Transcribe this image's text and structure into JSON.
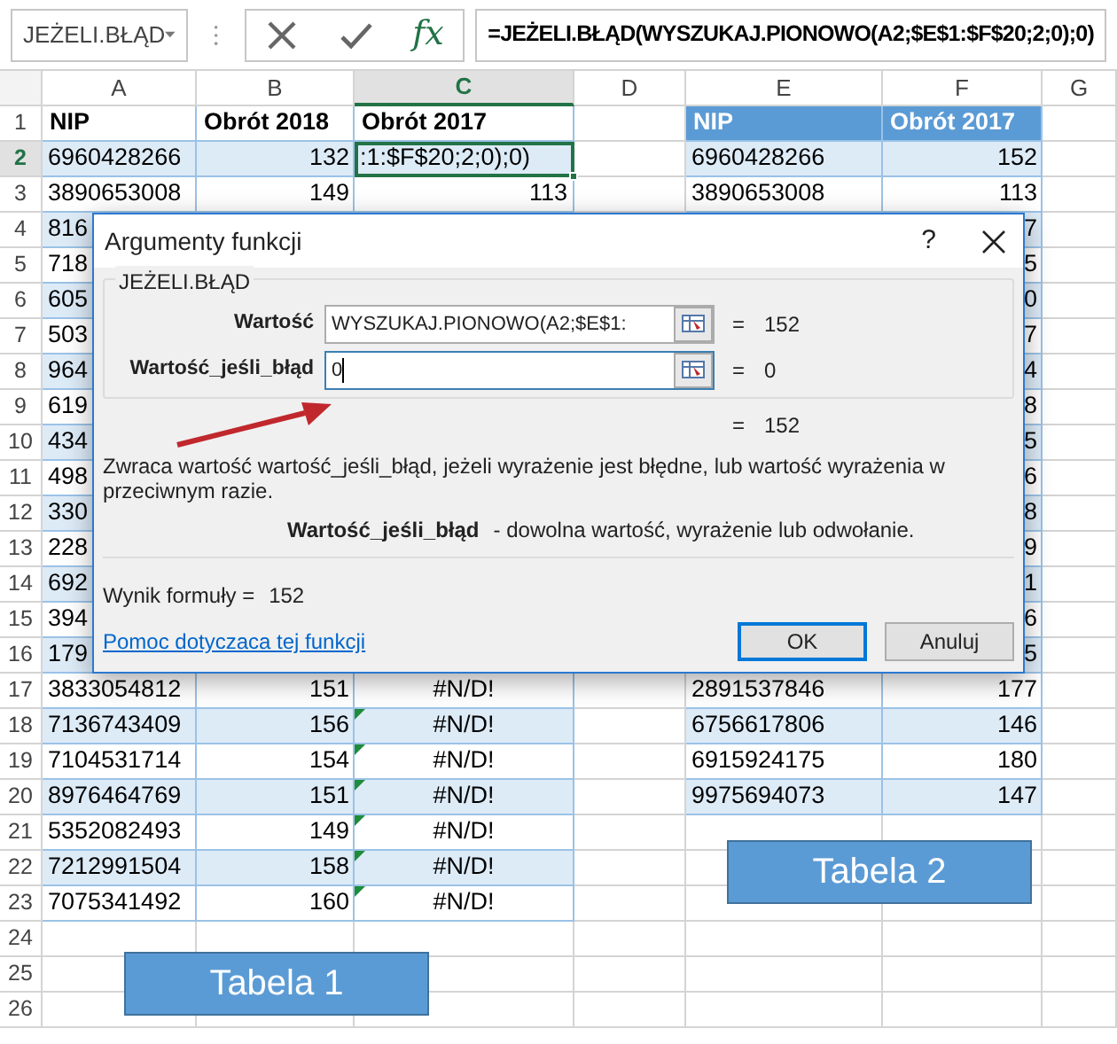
{
  "name_box": "JEŻELI.BŁĄD",
  "formula_bar": {
    "fx_label": "fx",
    "formula": "=JEŻELI.BŁĄD(WYSZUKAJ.PIONOWO(A2;$E$1:$F$20;2;0);0)"
  },
  "columns": [
    {
      "label": "A",
      "selected": false
    },
    {
      "label": "B",
      "selected": false
    },
    {
      "label": "C",
      "selected": true
    },
    {
      "label": "D",
      "selected": false
    },
    {
      "label": "E",
      "selected": false
    },
    {
      "label": "F",
      "selected": false
    },
    {
      "label": "G",
      "selected": false
    }
  ],
  "rows": [
    {
      "number": "1",
      "selected": false,
      "cells": {
        "A": "NIP",
        "B": "Obrót 2018",
        "C": "Obrót 2017",
        "E": "NIP",
        "F": "Obrót 2017"
      }
    },
    {
      "number": "2",
      "selected": true,
      "cells": {
        "A": "6960428266",
        "B": "132",
        "C": ":1:$F$20;2;0);0)",
        "E": "6960428266",
        "F": "152"
      }
    },
    {
      "number": "3",
      "selected": false,
      "cells": {
        "A": "3890653008",
        "B": "149",
        "C": "113",
        "E": "3890653008",
        "F": "113"
      }
    },
    {
      "number": "4",
      "selected": false,
      "cells": {
        "A": "816",
        "F": "7"
      }
    },
    {
      "number": "5",
      "selected": false,
      "cells": {
        "A": "718",
        "F": "5"
      }
    },
    {
      "number": "6",
      "selected": false,
      "cells": {
        "A": "605",
        "F": "0"
      }
    },
    {
      "number": "7",
      "selected": false,
      "cells": {
        "A": "503",
        "F": "7"
      }
    },
    {
      "number": "8",
      "selected": false,
      "cells": {
        "A": "964",
        "F": "4"
      }
    },
    {
      "number": "9",
      "selected": false,
      "cells": {
        "A": "619",
        "F": "8"
      }
    },
    {
      "number": "10",
      "selected": false,
      "cells": {
        "A": "434",
        "F": "5"
      }
    },
    {
      "number": "11",
      "selected": false,
      "cells": {
        "A": "498",
        "F": "6"
      }
    },
    {
      "number": "12",
      "selected": false,
      "cells": {
        "A": "330",
        "F": "8"
      }
    },
    {
      "number": "13",
      "selected": false,
      "cells": {
        "A": "228",
        "F": "9"
      }
    },
    {
      "number": "14",
      "selected": false,
      "cells": {
        "A": "692",
        "F": "1"
      }
    },
    {
      "number": "15",
      "selected": false,
      "cells": {
        "A": "394",
        "F": "6"
      }
    },
    {
      "number": "16",
      "selected": false,
      "cells": {
        "A": "179",
        "F": "5"
      }
    },
    {
      "number": "17",
      "selected": false,
      "cells": {
        "A": "3833054812",
        "B": "151",
        "C": "#N/D!",
        "E": "2891537846",
        "F": "177"
      }
    },
    {
      "number": "18",
      "selected": false,
      "flagged": true,
      "cells": {
        "A": "7136743409",
        "B": "156",
        "C": "#N/D!",
        "E": "6756617806",
        "F": "146"
      }
    },
    {
      "number": "19",
      "selected": false,
      "flagged": true,
      "cells": {
        "A": "7104531714",
        "B": "154",
        "C": "#N/D!",
        "E": "6915924175",
        "F": "180"
      }
    },
    {
      "number": "20",
      "selected": false,
      "flagged": true,
      "cells": {
        "A": "8976464769",
        "B": "151",
        "C": "#N/D!",
        "E": "9975694073",
        "F": "147"
      }
    },
    {
      "number": "21",
      "selected": false,
      "flagged": true,
      "cells": {
        "A": "5352082493",
        "B": "149",
        "C": "#N/D!"
      }
    },
    {
      "number": "22",
      "selected": false,
      "flagged": true,
      "cells": {
        "A": "7212991504",
        "B": "158",
        "C": "#N/D!"
      }
    },
    {
      "number": "23",
      "selected": false,
      "flagged": true,
      "cells": {
        "A": "7075341492",
        "B": "160",
        "C": "#N/D!"
      }
    },
    {
      "number": "24",
      "selected": false
    },
    {
      "number": "25",
      "selected": false
    },
    {
      "number": "26",
      "selected": false
    }
  ],
  "labels": [
    {
      "text": "Tabela 1"
    },
    {
      "text": "Tabela 2"
    }
  ],
  "dialog": {
    "title": "Argumenty funkcji",
    "help": "?",
    "function_name": "JEŻELI.BŁĄD",
    "arguments": [
      {
        "label": "Wartość",
        "value": "WYSZUKAJ.PIONOWO(A2;$E$1:",
        "equals": "=",
        "result": "152",
        "focused": false
      },
      {
        "label": "Wartość_jeśli_błąd",
        "value": "0",
        "equals": "=",
        "result": "0",
        "focused": true
      }
    ],
    "total_equals": "=",
    "total_result": "152",
    "description": "Zwraca wartość wartość_jeśli_błąd, jeżeli wyrażenie jest błędne, lub wartość wyrażenia w przeciwnym razie.",
    "param_name": "Wartość_jeśli_błąd",
    "param_description": "- dowolna wartość, wyrażenie lub odwołanie.",
    "result_label": "Wynik formuły =",
    "result_value": "152",
    "help_link": "Pomoc dotyczaca tej funkcji",
    "buttons": [
      {
        "label": "OK",
        "default": true
      },
      {
        "label": "Anuluj",
        "default": false
      }
    ]
  }
}
